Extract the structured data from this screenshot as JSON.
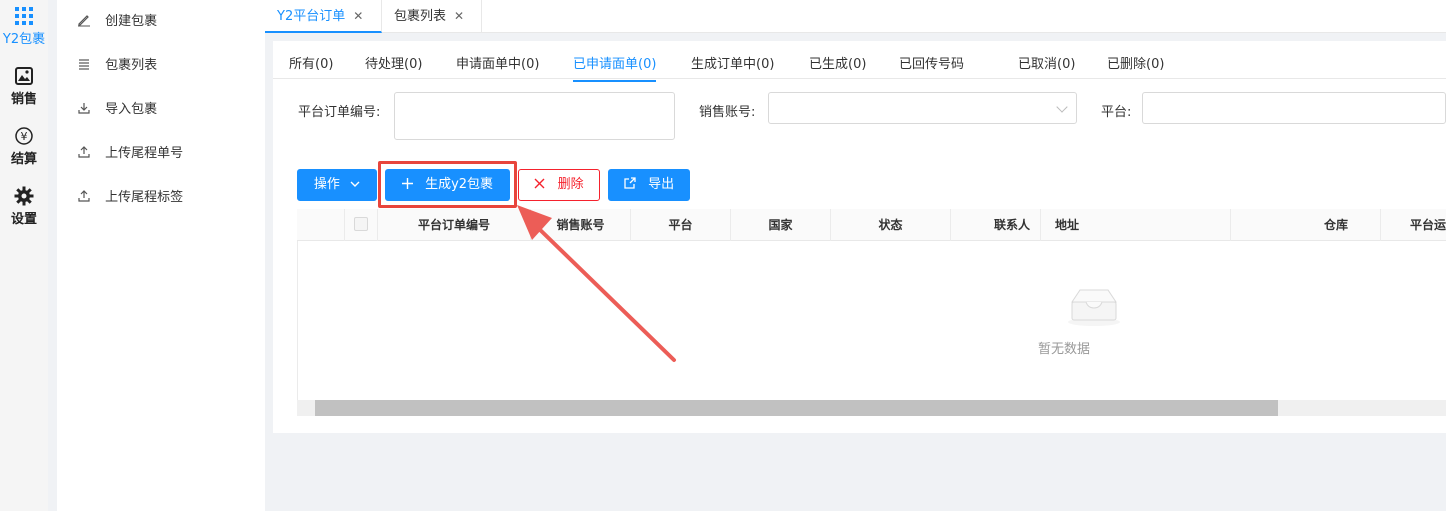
{
  "rail": {
    "items": [
      {
        "label": "Y2包裹",
        "icon": "grid-icon"
      },
      {
        "label": "销售",
        "icon": "image-icon"
      },
      {
        "label": "结算",
        "icon": "yuan-icon"
      },
      {
        "label": "设置",
        "icon": "gear-icon"
      }
    ]
  },
  "submenu": {
    "items": [
      {
        "label": "创建包裹",
        "icon": "edit-icon"
      },
      {
        "label": "包裹列表",
        "icon": "list-icon"
      },
      {
        "label": "导入包裹",
        "icon": "import-icon"
      },
      {
        "label": "上传尾程单号",
        "icon": "upload-icon"
      },
      {
        "label": "上传尾程标签",
        "icon": "upload-icon"
      }
    ]
  },
  "tabs": [
    {
      "label": "Y2平台订单",
      "close": "✕"
    },
    {
      "label": "包裹列表",
      "close": "✕"
    }
  ],
  "subtabs": [
    "所有(0)",
    "待处理(0)",
    "申请面单中(0)",
    "已申请面单(0)",
    "生成订单中(0)",
    "已生成(0)",
    "已回传号码",
    "已取消(0)",
    "已删除(0)"
  ],
  "filters": {
    "order_no_label": "平台订单编号:",
    "account_label": "销售账号:",
    "platform_label": "平台:"
  },
  "actions": {
    "operate": "操作",
    "generate": "生成y2包裹",
    "delete": "删除",
    "export": "导出"
  },
  "table": {
    "columns": [
      "平台订单编号",
      "销售账号",
      "平台",
      "国家",
      "状态",
      "联系人",
      "地址",
      "仓库",
      "平台运"
    ],
    "empty_text": "暂无数据"
  },
  "colors": {
    "accent": "#1890ff",
    "danger": "#f5222d",
    "annotation": "#e8453c"
  }
}
